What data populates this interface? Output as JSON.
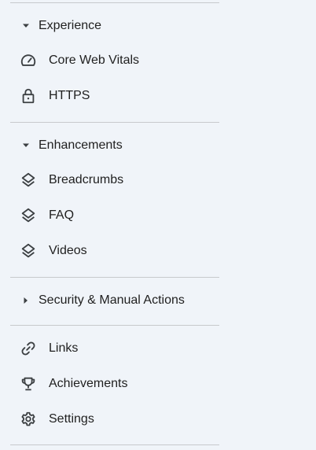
{
  "colors": {
    "background": "#f0f4f9",
    "text": "#1f1f1f",
    "icon": "#3c4043",
    "divider": "#c7c9cc"
  },
  "sections": {
    "experience": {
      "label": "Experience",
      "expanded": true,
      "caret_icon": "caret-down-icon",
      "items": [
        {
          "label": "Core Web Vitals",
          "icon": "speedometer-icon"
        },
        {
          "label": "HTTPS",
          "icon": "lock-icon"
        }
      ]
    },
    "enhancements": {
      "label": "Enhancements",
      "expanded": true,
      "caret_icon": "caret-down-icon",
      "items": [
        {
          "label": "Breadcrumbs",
          "icon": "layers-icon"
        },
        {
          "label": "FAQ",
          "icon": "layers-icon"
        },
        {
          "label": "Videos",
          "icon": "layers-icon"
        }
      ]
    },
    "security": {
      "label": "Security & Manual Actions",
      "expanded": false,
      "caret_icon": "caret-right-icon"
    }
  },
  "footer_items": [
    {
      "label": "Links",
      "icon": "link-icon"
    },
    {
      "label": "Achievements",
      "icon": "trophy-icon"
    },
    {
      "label": "Settings",
      "icon": "gear-icon"
    }
  ]
}
